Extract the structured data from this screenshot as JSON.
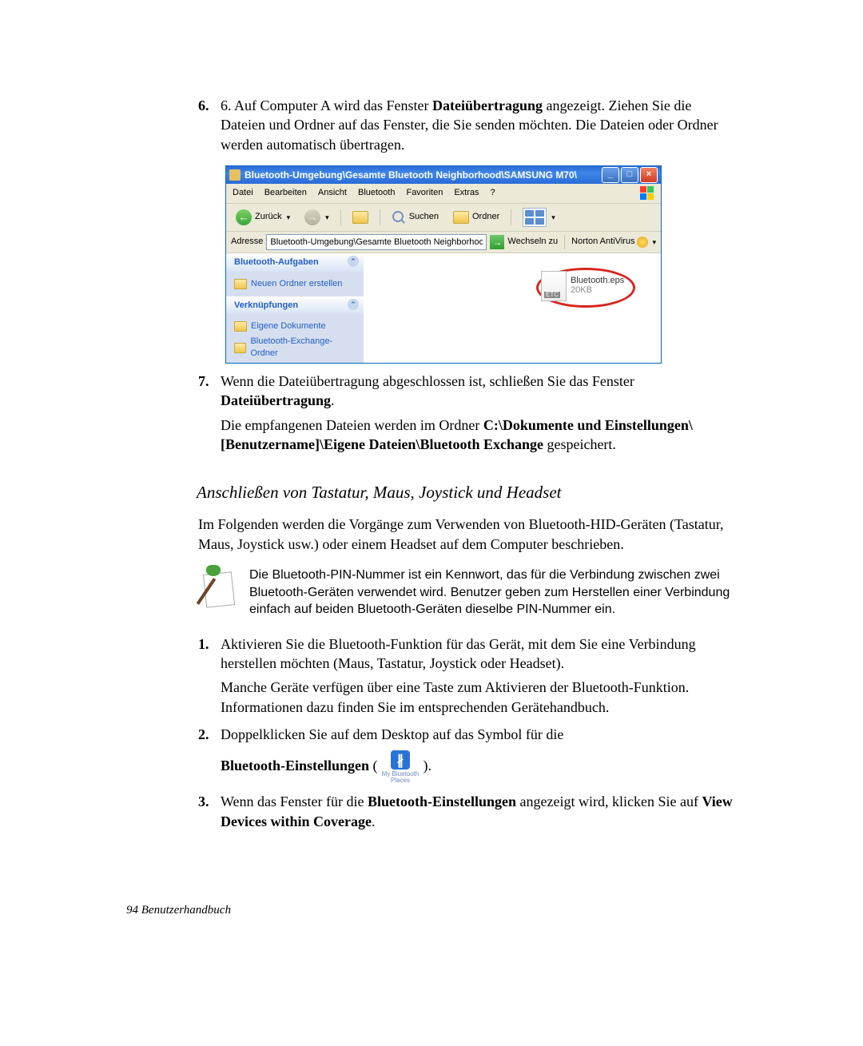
{
  "step6": {
    "num": "6.",
    "text_a": "6. Auf Computer A wird das Fenster ",
    "bold_a": "Dateiübertragung",
    "text_b": " angezeigt. Ziehen Sie die Dateien und Ordner auf das Fenster, die Sie senden möchten. Die Dateien oder Ordner werden automatisch übertragen."
  },
  "win": {
    "title": "Bluetooth-Umgebung\\Gesamte Bluetooth Neighborhood\\SAMSUNG M70\\",
    "menus": [
      "Datei",
      "Bearbeiten",
      "Ansicht",
      "Bluetooth",
      "Favoriten",
      "Extras",
      "?"
    ],
    "back": "Zurück",
    "search": "Suchen",
    "folders": "Ordner",
    "addr_label": "Adresse",
    "addr_value": "Bluetooth-Umgebung\\Gesamte Bluetooth Neighborhood\\SAMSUN",
    "go": "Wechseln zu",
    "norton": "Norton AntiVirus",
    "panel1_title": "Bluetooth-Aufgaben",
    "panel1_item": "Neuen Ordner erstellen",
    "panel2_title": "Verknüpfungen",
    "panel2_item1": "Eigene Dokumente",
    "panel2_item2": "Bluetooth-Exchange-Ordner",
    "file_name": "Bluetooth.eps",
    "file_size": "20KB"
  },
  "step7": {
    "num": "7.",
    "part1_a": "Wenn die Dateiübertragung abgeschlossen ist, schließen Sie das Fenster ",
    "part1_b": "Dateiübertragung",
    "part1_c": ".",
    "part2_a": "Die empfangenen Dateien werden im Ordner ",
    "part2_b": "C:\\Dokumente und Einstellungen\\[Benutzername]\\Eigene Dateien\\Bluetooth Exchange",
    "part2_c": " gespeichert."
  },
  "subheading": "Anschließen von Tastatur, Maus, Joystick und Headset",
  "intro2": "Im Folgenden werden die Vorgänge zum Verwenden von Bluetooth-HID-Geräten (Tastatur, Maus, Joystick usw.) oder einem Headset auf dem Computer beschrieben.",
  "note": "Die Bluetooth-PIN-Nummer ist ein Kennwort, das für die Verbindung zwischen zwei Bluetooth-Geräten verwendet wird. Benutzer geben zum Herstellen einer Verbindung einfach auf beiden Bluetooth-Geräten dieselbe PIN-Nummer ein.",
  "b1": {
    "num": "1.",
    "p1": "Aktivieren Sie die Bluetooth-Funktion für das Gerät, mit dem Sie eine Verbindung herstellen möchten (Maus, Tastatur, Joystick oder Headset).",
    "p2": "Manche Geräte verfügen über eine Taste zum Aktivieren der Bluetooth-Funktion. Informationen dazu finden Sie im entsprechenden Gerätehandbuch."
  },
  "b2": {
    "num": "2.",
    "p1": "Doppelklicken Sie auf dem Desktop auf das Symbol für die",
    "bold": "Bluetooth-Einstellungen",
    "icon_caption": "My Bluetooth Places",
    "open": " (",
    "close": ")."
  },
  "b3": {
    "num": "3.",
    "a": "Wenn das Fenster für die ",
    "b": "Bluetooth-Einstellungen",
    "c": " angezeigt wird, klicken Sie auf ",
    "d": "View Devices within Coverage",
    "e": "."
  },
  "footer": "94  Benutzerhandbuch"
}
